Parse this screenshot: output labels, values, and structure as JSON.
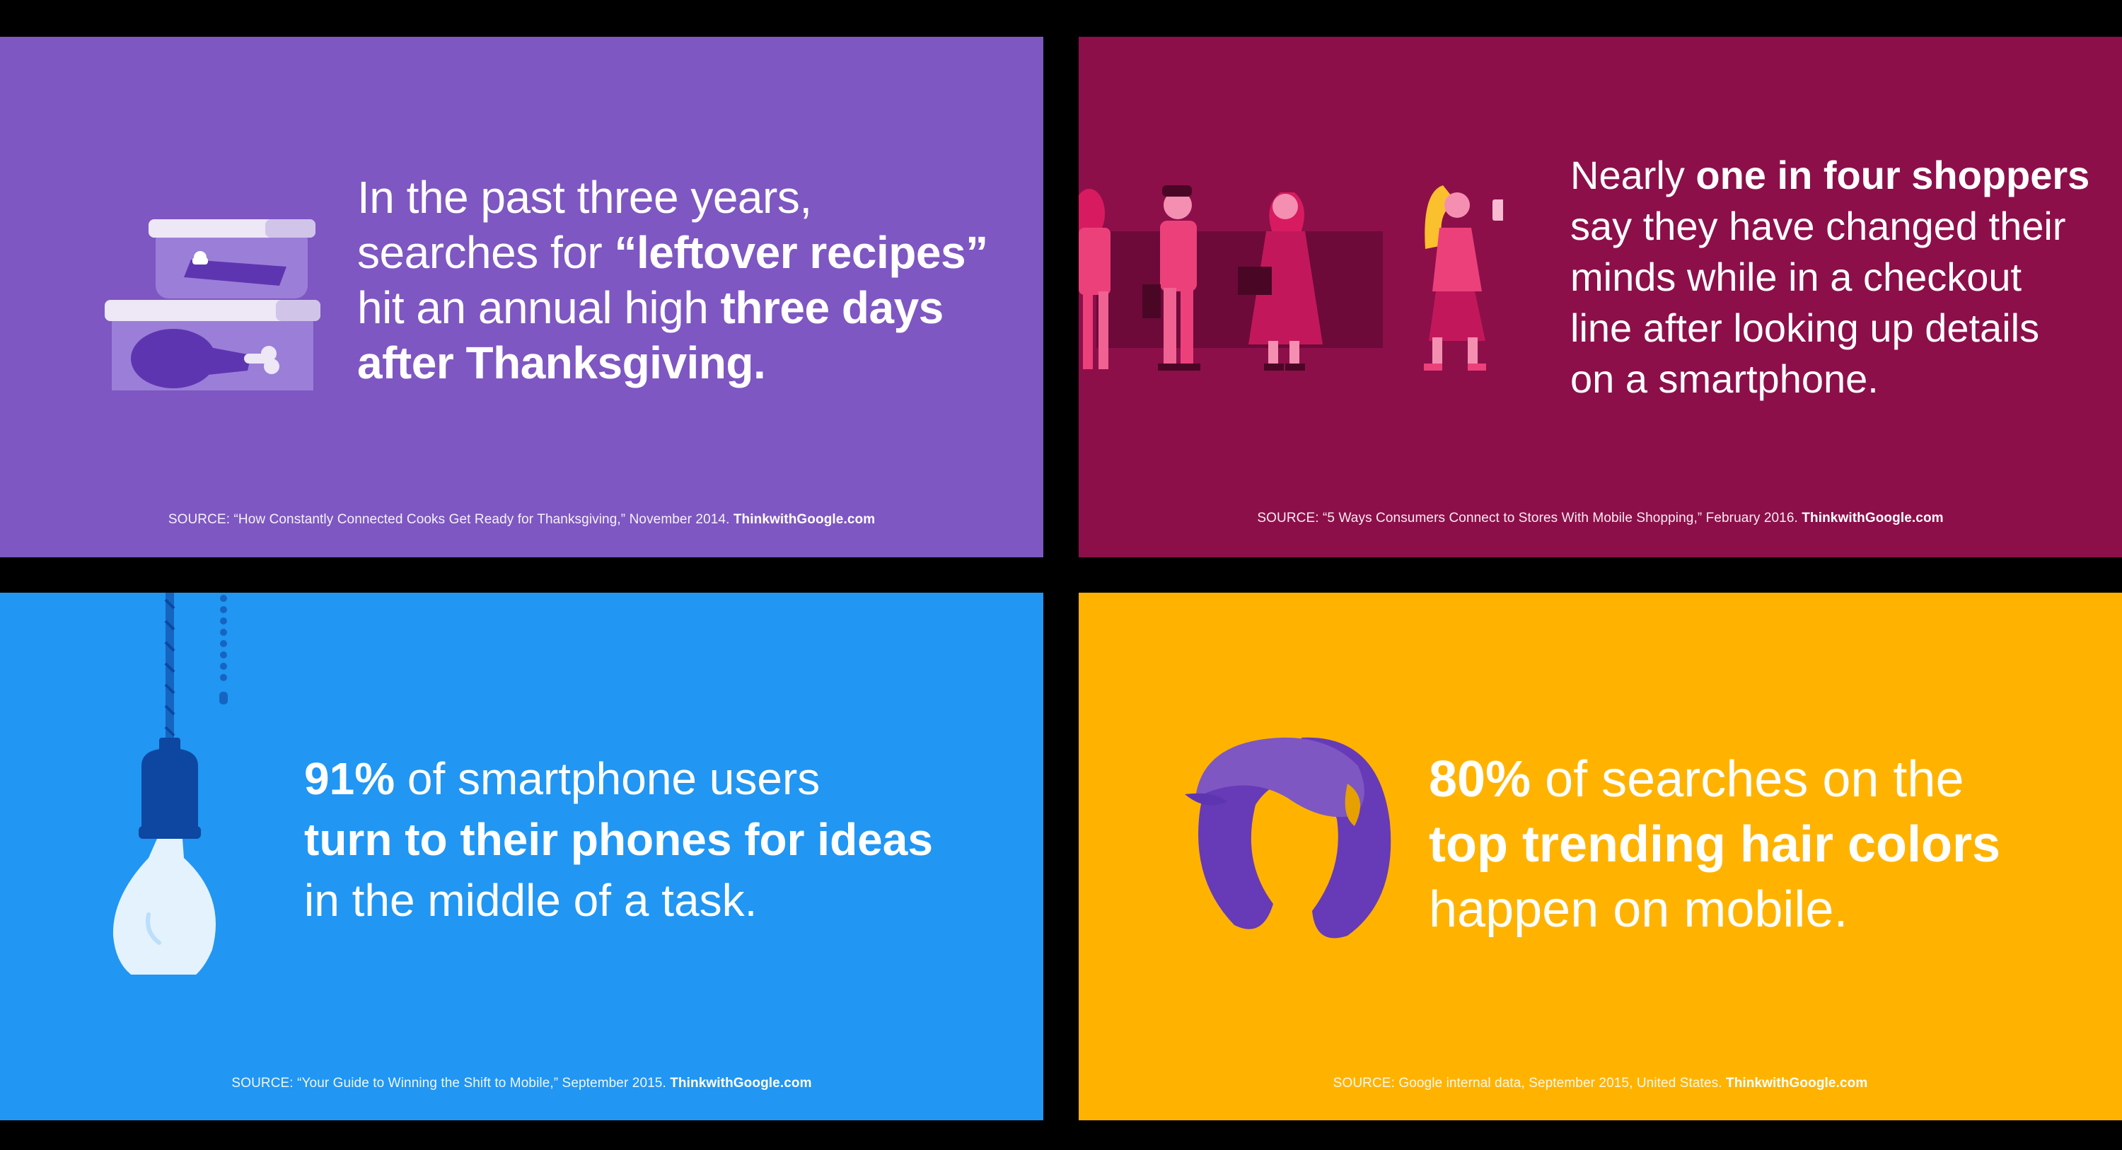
{
  "cards": [
    {
      "background": "#7e57c2",
      "headline": {
        "p1": "In the past three years,",
        "p2": "searches for ",
        "b1": "“leftover recipes”",
        "p3": "hit an annual high ",
        "b2": "three days",
        "b3": "after Thanksgiving."
      },
      "source": "SOURCE: “How Constantly Connected Cooks Get Ready for Thanksgiving,” November 2014.",
      "brand": "ThinkwithGoogle.com",
      "icon": "leftover-containers-illustration"
    },
    {
      "background": "#8c0f4a",
      "headline": {
        "p1": "Nearly ",
        "b1": "one in four shoppers",
        "p2": "say they have changed their",
        "p3": "minds while in a checkout",
        "p4": "line after looking up details",
        "p5": "on a smartphone."
      },
      "source": "SOURCE: “5 Ways Consumers Connect to Stores With Mobile Shopping,” February 2016.",
      "brand": "ThinkwithGoogle.com",
      "icon": "checkout-line-illustration"
    },
    {
      "background": "#2196f3",
      "headline": {
        "b1": "91%",
        "p1": " of smartphone users",
        "b2": "turn to their phones for ideas",
        "p2": "in the middle of a task."
      },
      "source": "SOURCE: “Your Guide to Winning the Shift to Mobile,” September 2015.",
      "brand": "ThinkwithGoogle.com",
      "icon": "light-bulb-illustration"
    },
    {
      "background": "#ffb300",
      "headline": {
        "b1": "80%",
        "p1": " of searches on the",
        "b2": "top trending hair colors",
        "p2": "happen on mobile."
      },
      "source": "SOURCE: Google internal data, September 2015, United States.",
      "brand": "ThinkwithGoogle.com",
      "icon": "hair-illustration"
    }
  ]
}
